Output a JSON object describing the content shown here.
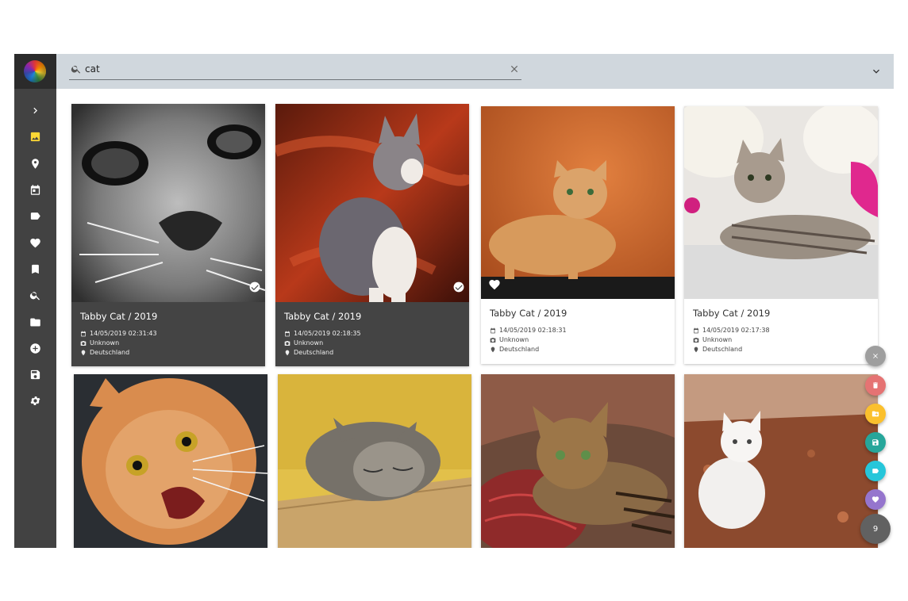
{
  "search": {
    "query": "cat"
  },
  "sidebar": {
    "items": [
      {
        "name": "expand",
        "icon": "chevron-right-icon"
      },
      {
        "name": "photos",
        "icon": "image-icon"
      },
      {
        "name": "places",
        "icon": "map-marker-icon"
      },
      {
        "name": "calendar",
        "icon": "calendar-icon"
      },
      {
        "name": "labels",
        "icon": "label-icon"
      },
      {
        "name": "favorites",
        "icon": "heart-icon"
      },
      {
        "name": "albums",
        "icon": "bookmark-icon"
      },
      {
        "name": "search",
        "icon": "search-icon"
      },
      {
        "name": "folders",
        "icon": "folder-icon"
      },
      {
        "name": "import",
        "icon": "add-circle-icon"
      },
      {
        "name": "library",
        "icon": "save-icon"
      },
      {
        "name": "settings",
        "icon": "gear-icon"
      }
    ]
  },
  "cards": [
    {
      "title": "Tabby Cat / 2019",
      "date": "14/05/2019 02:31:43",
      "camera": "Unknown",
      "location": "Deutschland",
      "selected": true,
      "favorite": false
    },
    {
      "title": "Tabby Cat / 2019",
      "date": "14/05/2019 02:18:35",
      "camera": "Unknown",
      "location": "Deutschland",
      "selected": true,
      "favorite": false
    },
    {
      "title": "Tabby Cat / 2019",
      "date": "14/05/2019 02:18:31",
      "camera": "Unknown",
      "location": "Deutschland",
      "selected": false,
      "favorite": true
    },
    {
      "title": "Tabby Cat / 2019",
      "date": "14/05/2019 02:17:38",
      "camera": "Unknown",
      "location": "Deutschland",
      "selected": false,
      "favorite": false
    },
    {
      "selected": false
    },
    {
      "selected": false
    },
    {
      "selected": false
    },
    {
      "selected": false
    }
  ],
  "actions": {
    "count": "9",
    "colors": {
      "close": "#9e9e9e",
      "delete": "#e57373",
      "album": "#fbc02d",
      "download": "#26a69a",
      "label": "#26c6da",
      "favorite": "#9575cd",
      "count": "#616161"
    }
  },
  "colors": {
    "sidebar": "#424242",
    "toolbar": "#d0d7dd",
    "accent": "#fdd835",
    "selected_card": "#444444"
  }
}
